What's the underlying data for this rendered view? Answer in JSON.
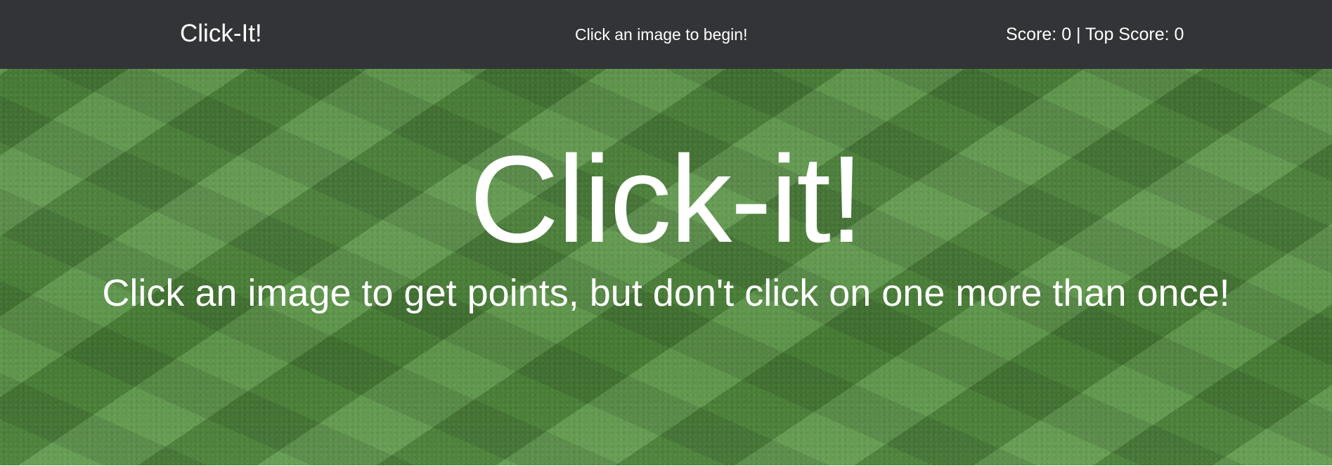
{
  "navbar": {
    "brand": "Click-It!",
    "message": "Click an image to begin!",
    "score_text": "Score: 0 | Top Score: 0"
  },
  "hero": {
    "title": "Click-it!",
    "subtitle": "Click an image to get points, but don't click on one more than once!"
  },
  "colors": {
    "navbar_bg": "#333438",
    "text": "#ffffff",
    "grass_green": "#4f8a3c"
  }
}
